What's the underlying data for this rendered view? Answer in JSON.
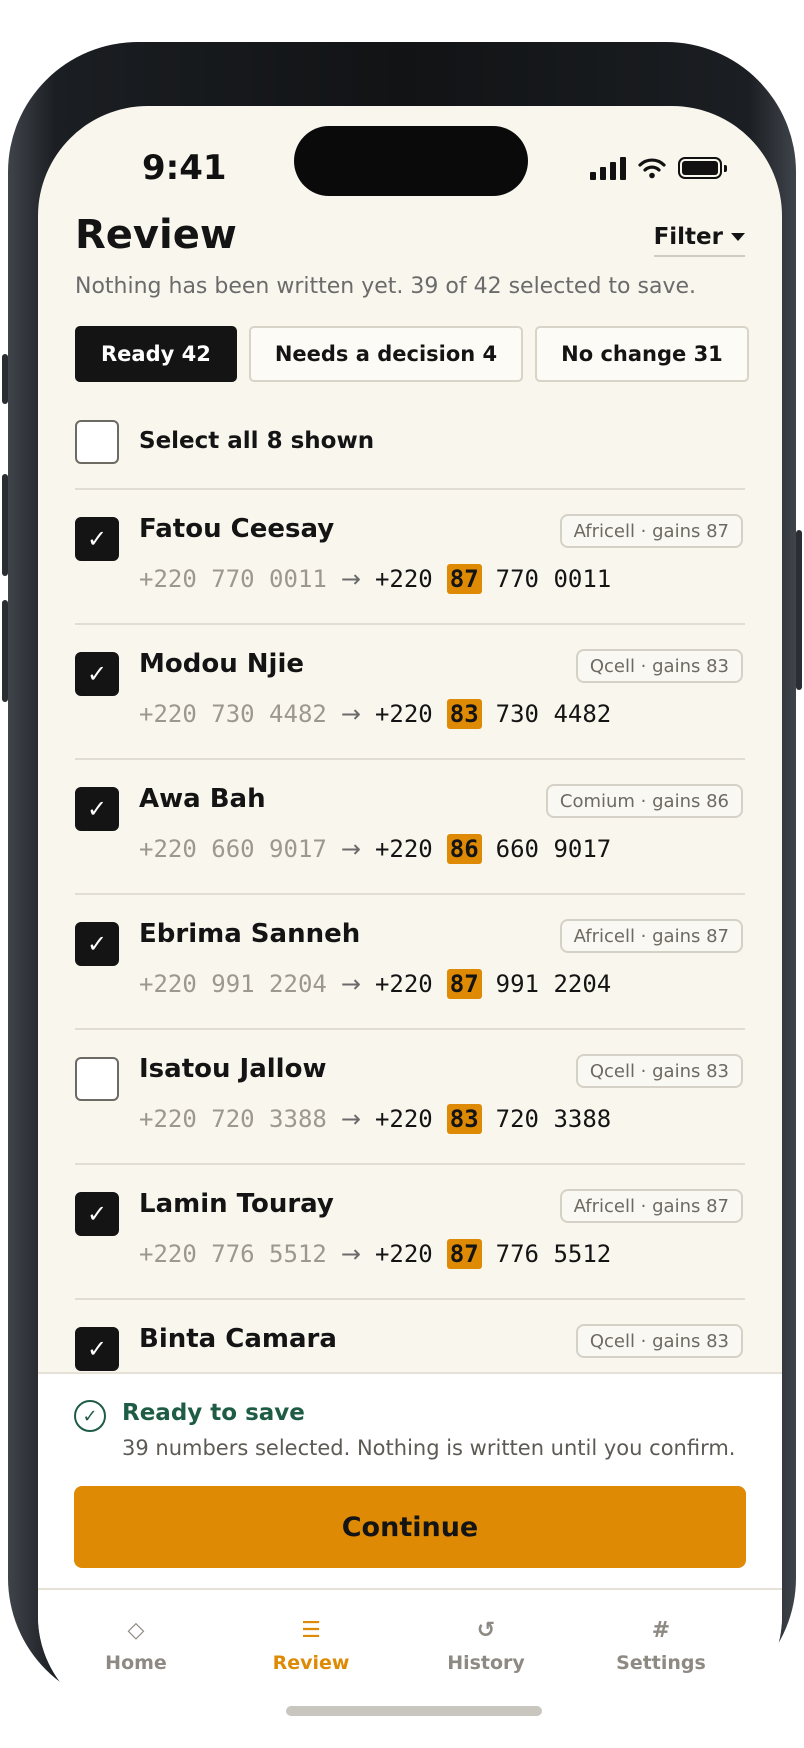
{
  "status": {
    "time": "9:41"
  },
  "header": {
    "title": "Review",
    "filter_label": "Filter",
    "subtitle": "Nothing has been written yet. 39 of 42 selected to save."
  },
  "tabs": [
    {
      "label": "Ready 42",
      "active": true
    },
    {
      "label": "Needs a decision 4",
      "active": false
    },
    {
      "label": "No change 31",
      "active": false
    }
  ],
  "select_all": {
    "label": "Select all 8 shown",
    "checked": false
  },
  "contacts": [
    {
      "name": "Fatou Ceesay",
      "badge": "Africell · gains 87",
      "old": "+220 770 0011",
      "country": "+220",
      "prefix": "87",
      "rest": "770 0011",
      "checked": true
    },
    {
      "name": "Modou Njie",
      "badge": "Qcell · gains 83",
      "old": "+220 730 4482",
      "country": "+220",
      "prefix": "83",
      "rest": "730 4482",
      "checked": true
    },
    {
      "name": "Awa Bah",
      "badge": "Comium · gains 86",
      "old": "+220 660 9017",
      "country": "+220",
      "prefix": "86",
      "rest": "660 9017",
      "checked": true
    },
    {
      "name": "Ebrima Sanneh",
      "badge": "Africell · gains 87",
      "old": "+220 991 2204",
      "country": "+220",
      "prefix": "87",
      "rest": "991 2204",
      "checked": true
    },
    {
      "name": "Isatou Jallow",
      "badge": "Qcell · gains 83",
      "old": "+220 720 3388",
      "country": "+220",
      "prefix": "83",
      "rest": "720 3388",
      "checked": false
    },
    {
      "name": "Lamin Touray",
      "badge": "Africell · gains 87",
      "old": "+220 776 5512",
      "country": "+220",
      "prefix": "87",
      "rest": "776 5512",
      "checked": true
    },
    {
      "name": "Binta Camara",
      "badge": "Qcell · gains 83",
      "checked": true
    }
  ],
  "arrow": "→",
  "checkmark": "✓",
  "footer": {
    "ready_title": "Ready to save",
    "ready_sub": "39 numbers selected. Nothing is written until you confirm.",
    "continue_label": "Continue"
  },
  "tabbar": [
    {
      "icon": "◇",
      "icon_name": "home-icon",
      "label": "Home",
      "active": false
    },
    {
      "icon": "☰",
      "icon_name": "review-icon",
      "label": "Review",
      "active": true
    },
    {
      "icon": "↺",
      "icon_name": "history-icon",
      "label": "History",
      "active": false
    },
    {
      "icon": "#",
      "icon_name": "settings-icon",
      "label": "Settings",
      "active": false
    }
  ],
  "colors": {
    "accent": "#de8a05",
    "ready_green": "#1f5c46",
    "background": "#f9f6ee",
    "ink": "#141414"
  }
}
